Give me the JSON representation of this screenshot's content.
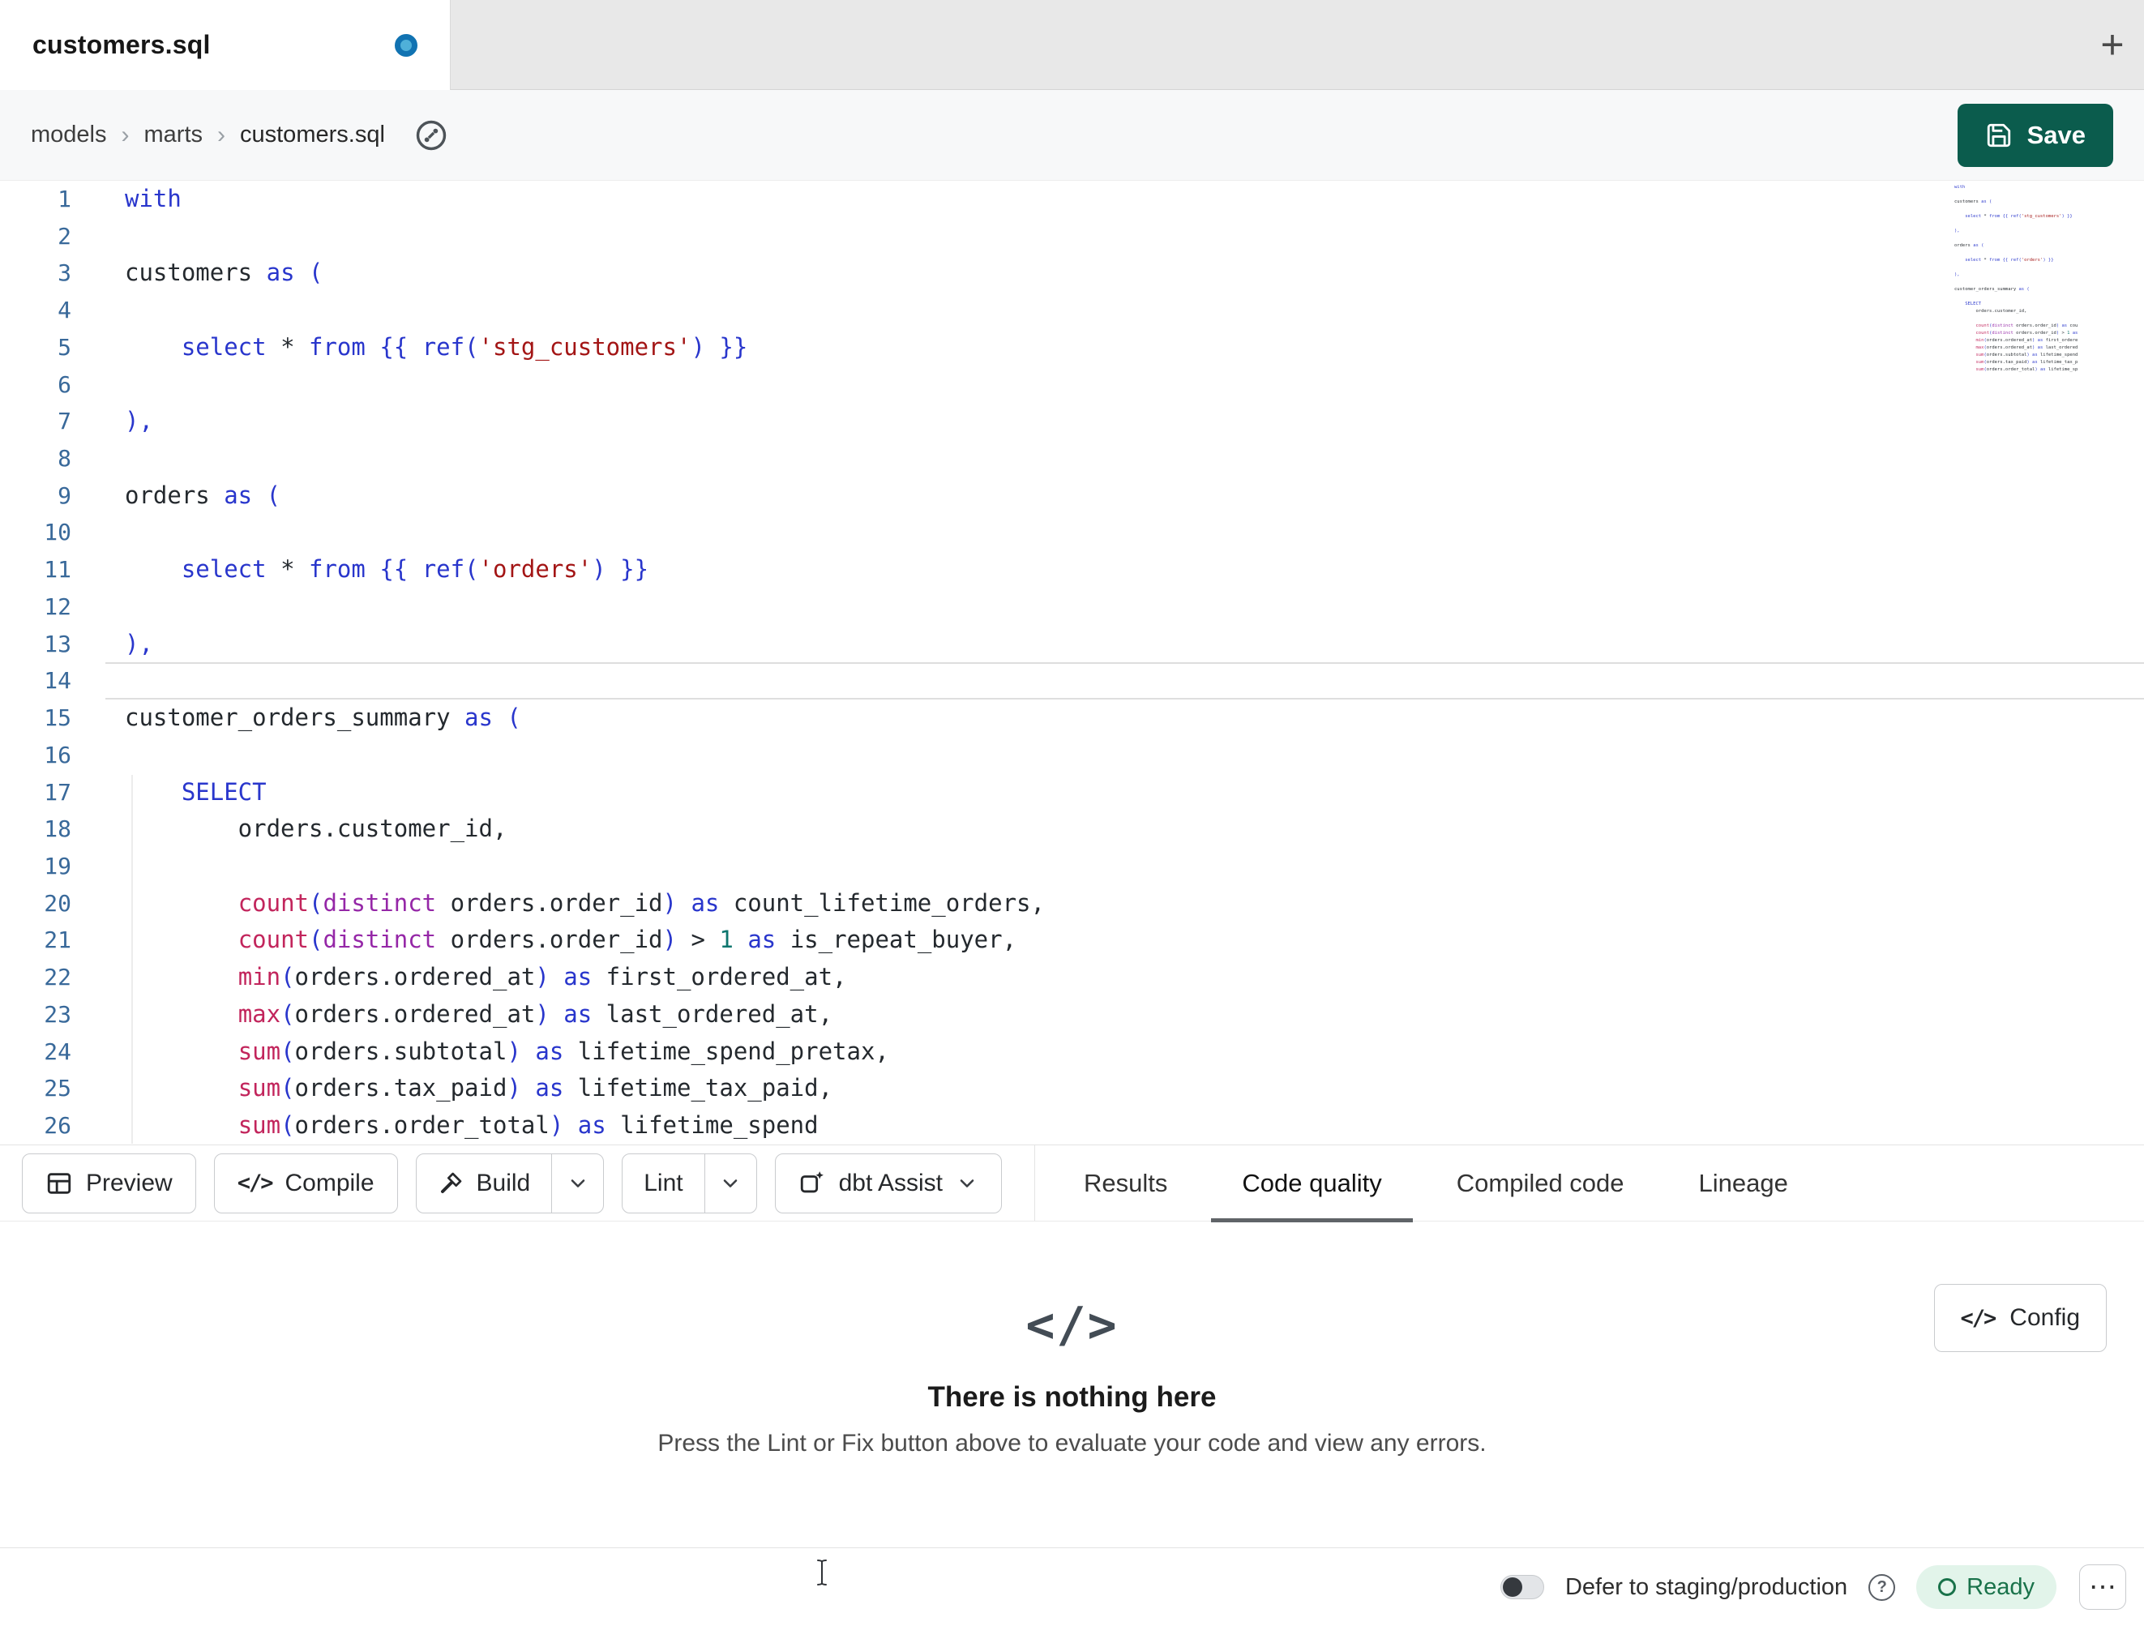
{
  "palette": {
    "save_green": "#0b5c4d",
    "unsaved_dot_blue": "#1173b2",
    "ready_green": "#19724a",
    "ready_bg": "#e2f4ea",
    "keyword_blue": "#2936cc",
    "function_red": "#c2255c",
    "modifier_purple": "#9527a7",
    "string_red": "#a31515",
    "number_teal": "#0d766e",
    "active_tab_underline": "#606468"
  },
  "icons": {
    "plus": "+",
    "code": "</>",
    "help": "?",
    "ellipsis": "⋯"
  },
  "tab_bar": {
    "title": "customers.sql"
  },
  "breadcrumb": {
    "items": [
      "models",
      "marts",
      "customers.sql"
    ],
    "separator": "›"
  },
  "save": {
    "label": "Save"
  },
  "editor": {
    "active_line": 14,
    "lines": [
      {
        "n": 1,
        "t": [
          [
            "k",
            "with"
          ]
        ]
      },
      {
        "n": 2,
        "t": []
      },
      {
        "n": 3,
        "t": [
          [
            "t",
            "customers "
          ],
          [
            "k",
            "as ("
          ]
        ]
      },
      {
        "n": 4,
        "t": []
      },
      {
        "n": 5,
        "t": [
          [
            "t",
            "    "
          ],
          [
            "k",
            "select"
          ],
          [
            "t",
            " * "
          ],
          [
            "k",
            "from"
          ],
          [
            "t",
            " "
          ],
          [
            "k",
            "{{ ref("
          ],
          [
            "s",
            "'stg_customers'"
          ],
          [
            "k",
            ") }}"
          ]
        ]
      },
      {
        "n": 6,
        "t": []
      },
      {
        "n": 7,
        "t": [
          [
            "k",
            "),"
          ]
        ]
      },
      {
        "n": 8,
        "t": []
      },
      {
        "n": 9,
        "t": [
          [
            "t",
            "orders "
          ],
          [
            "k",
            "as ("
          ]
        ]
      },
      {
        "n": 10,
        "t": []
      },
      {
        "n": 11,
        "t": [
          [
            "t",
            "    "
          ],
          [
            "k",
            "select"
          ],
          [
            "t",
            " * "
          ],
          [
            "k",
            "from"
          ],
          [
            "t",
            " "
          ],
          [
            "k",
            "{{ ref("
          ],
          [
            "s",
            "'orders'"
          ],
          [
            "k",
            ") }}"
          ]
        ]
      },
      {
        "n": 12,
        "t": []
      },
      {
        "n": 13,
        "t": [
          [
            "k",
            "),"
          ]
        ]
      },
      {
        "n": 14,
        "t": []
      },
      {
        "n": 15,
        "t": [
          [
            "t",
            "customer_orders_summary "
          ],
          [
            "k",
            "as ("
          ]
        ]
      },
      {
        "n": 16,
        "t": []
      },
      {
        "n": 17,
        "t": [
          [
            "t",
            "    "
          ],
          [
            "k",
            "SELECT"
          ]
        ]
      },
      {
        "n": 18,
        "t": [
          [
            "t",
            "        orders.customer_id,"
          ]
        ]
      },
      {
        "n": 19,
        "t": []
      },
      {
        "n": 20,
        "t": [
          [
            "t",
            "        "
          ],
          [
            "f",
            "count"
          ],
          [
            "k",
            "("
          ],
          [
            "m",
            "distinct"
          ],
          [
            "t",
            " orders.order_id"
          ],
          [
            "k",
            ")"
          ],
          [
            "t",
            " "
          ],
          [
            "k",
            "as"
          ],
          [
            "t",
            " count_lifetime_orders,"
          ]
        ]
      },
      {
        "n": 21,
        "t": [
          [
            "t",
            "        "
          ],
          [
            "f",
            "count"
          ],
          [
            "k",
            "("
          ],
          [
            "m",
            "distinct"
          ],
          [
            "t",
            " orders.order_id"
          ],
          [
            "k",
            ")"
          ],
          [
            "t",
            " > "
          ],
          [
            "n",
            "1"
          ],
          [
            "t",
            " "
          ],
          [
            "k",
            "as"
          ],
          [
            "t",
            " is_repeat_buyer,"
          ]
        ]
      },
      {
        "n": 22,
        "t": [
          [
            "t",
            "        "
          ],
          [
            "f",
            "min"
          ],
          [
            "k",
            "("
          ],
          [
            "t",
            "orders.ordered_at"
          ],
          [
            "k",
            ")"
          ],
          [
            "t",
            " "
          ],
          [
            "k",
            "as"
          ],
          [
            "t",
            " first_ordered_at,"
          ]
        ]
      },
      {
        "n": 23,
        "t": [
          [
            "t",
            "        "
          ],
          [
            "f",
            "max"
          ],
          [
            "k",
            "("
          ],
          [
            "t",
            "orders.ordered_at"
          ],
          [
            "k",
            ")"
          ],
          [
            "t",
            " "
          ],
          [
            "k",
            "as"
          ],
          [
            "t",
            " last_ordered_at,"
          ]
        ]
      },
      {
        "n": 24,
        "t": [
          [
            "t",
            "        "
          ],
          [
            "f",
            "sum"
          ],
          [
            "k",
            "("
          ],
          [
            "t",
            "orders.subtotal"
          ],
          [
            "k",
            ")"
          ],
          [
            "t",
            " "
          ],
          [
            "k",
            "as"
          ],
          [
            "t",
            " lifetime_spend_pretax,"
          ]
        ]
      },
      {
        "n": 25,
        "t": [
          [
            "t",
            "        "
          ],
          [
            "f",
            "sum"
          ],
          [
            "k",
            "("
          ],
          [
            "t",
            "orders.tax_paid"
          ],
          [
            "k",
            ")"
          ],
          [
            "t",
            " "
          ],
          [
            "k",
            "as"
          ],
          [
            "t",
            " lifetime_tax_paid,"
          ]
        ]
      },
      {
        "n": 26,
        "t": [
          [
            "t",
            "        "
          ],
          [
            "f",
            "sum"
          ],
          [
            "k",
            "("
          ],
          [
            "t",
            "orders.order_total"
          ],
          [
            "k",
            ")"
          ],
          [
            "t",
            " "
          ],
          [
            "k",
            "as"
          ],
          [
            "t",
            " lifetime_spend"
          ]
        ]
      }
    ]
  },
  "toolbar": {
    "preview": "Preview",
    "compile": "Compile",
    "build": "Build",
    "lint": "Lint",
    "assist": "dbt Assist"
  },
  "panel_tabs": [
    {
      "label": "Results",
      "active": false
    },
    {
      "label": "Code quality",
      "active": true
    },
    {
      "label": "Compiled code",
      "active": false
    },
    {
      "label": "Lineage",
      "active": false
    }
  ],
  "empty_state": {
    "title": "There is nothing here",
    "subtitle": "Press the Lint or Fix button above to evaluate your code and view any errors.",
    "config": "Config"
  },
  "status_bar": {
    "defer_label": "Defer to staging/production",
    "ready": "Ready"
  }
}
